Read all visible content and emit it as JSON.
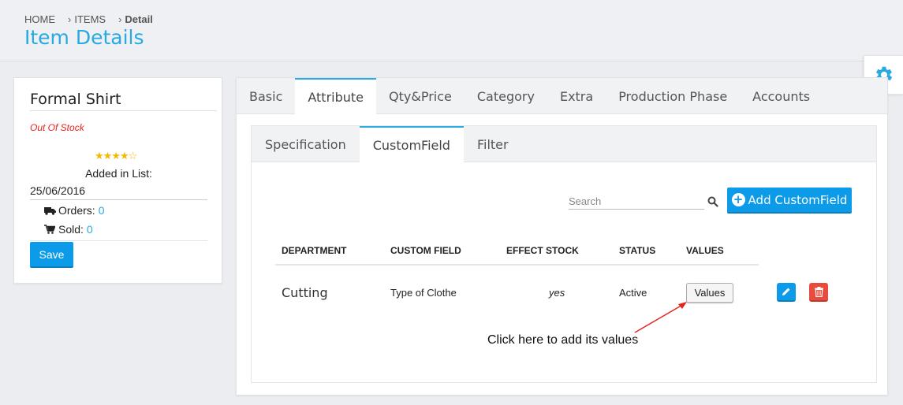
{
  "breadcrumb": {
    "home": "HOME",
    "items": "ITEMS",
    "current": "Detail"
  },
  "page_title": "Item Details",
  "profile": {
    "name": "Formal Shirt",
    "stock_status": "Out Of Stock",
    "rating": 4,
    "rating_max": 5,
    "added_label": "Added in List:",
    "added_date": "25/06/2016",
    "orders_label": "Orders:",
    "orders_value": "0",
    "sold_label": "Sold:",
    "sold_value": "0",
    "save_label": "Save"
  },
  "tabs": [
    {
      "label": "Basic"
    },
    {
      "label": "Attribute"
    },
    {
      "label": "Qty&Price"
    },
    {
      "label": "Category"
    },
    {
      "label": "Extra"
    },
    {
      "label": "Production Phase"
    },
    {
      "label": "Accounts"
    }
  ],
  "active_tab": "Attribute",
  "subtabs": [
    {
      "label": "Specification"
    },
    {
      "label": "CustomField"
    },
    {
      "label": "Filter"
    }
  ],
  "active_subtab": "CustomField",
  "search": {
    "placeholder": "Search"
  },
  "add_button_label": "Add CustomField",
  "table": {
    "headers": [
      "DEPARTMENT",
      "CUSTOM FIELD",
      "EFFECT STOCK",
      "STATUS",
      "VALUES"
    ],
    "rows": [
      {
        "department": "Cutting",
        "custom_field": "Type of Clothe",
        "effect_stock": "yes",
        "status": "Active",
        "values_button": "Values"
      }
    ]
  },
  "annotation": "Click here to add its values",
  "colors": {
    "accent": "#27a9e1",
    "primary_button": "#0c9be8",
    "danger": "#e84c3d",
    "stock_status": "#e5251c",
    "star": "#f5b800"
  }
}
